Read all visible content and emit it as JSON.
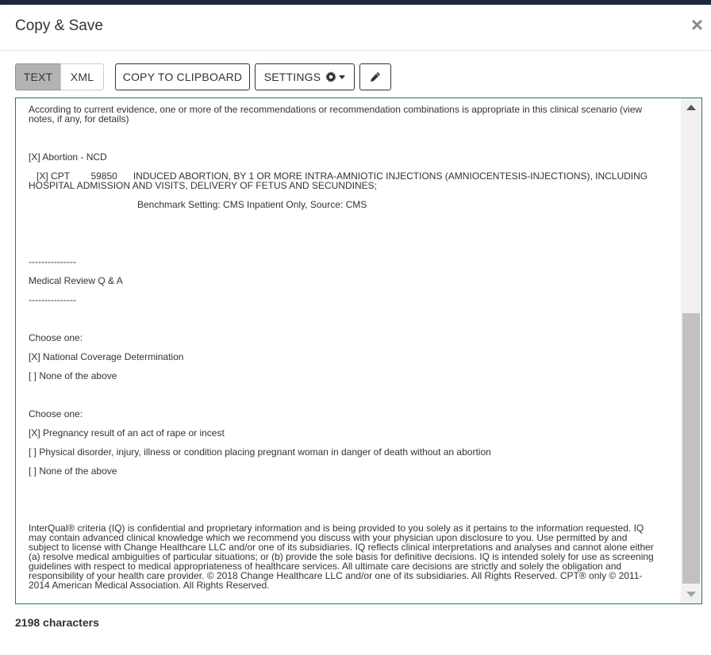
{
  "dialog": {
    "title": "Copy & Save",
    "close_label": "×"
  },
  "toolbar": {
    "text_tab": "TEXT",
    "xml_tab": "XML",
    "copy_label": "COPY TO CLIPBOARD",
    "settings_label": "SETTINGS",
    "settings_icon": "gear-icon",
    "edit_icon": "pencil-icon"
  },
  "content": {
    "lines": [
      "According to current evidence, one or more of the recommendations or recommendation combinations is appropriate in this clinical scenario (view notes, if any, for details)",
      "[X] Abortion - NCD",
      "   [X] CPT        59850      INDUCED ABORTION, BY 1 OR MORE INTRA-AMNIOTIC INJECTIONS (AMNIOCENTESIS-INJECTIONS), INCLUDING HOSPITAL ADMISSION AND VISITS, DELIVERY OF FETUS AND SECUNDINES;",
      "Benchmark Setting: CMS Inpatient Only, Source: CMS",
      "---------------",
      "Medical Review Q & A",
      "---------------",
      "Choose one:",
      "[X] National Coverage Determination",
      "[ ] None of the above",
      "Choose one:",
      "[X] Pregnancy result of an act of rape or incest",
      "[ ] Physical disorder, injury, illness or condition placing pregnant woman in danger of death without an abortion",
      "[ ] None of the above",
      "InterQual® criteria (IQ) is confidential and proprietary information and is being provided to you solely as it pertains to the information requested. IQ may contain advanced clinical knowledge which we recommend you discuss with your physician upon disclosure to you. Use permitted by and subject to license with Change Healthcare LLC and/or one of its subsidiaries. IQ reflects clinical interpretations and analyses and cannot alone either (a) resolve medical ambiguities of particular situations; or (b) provide the sole basis for definitive decisions. IQ is intended solely for use as screening guidelines with respect to medical appropriateness of healthcare services. All ultimate care decisions are strictly and solely the obligation and responsibility of your health care provider. © 2018 Change Healthcare LLC and/or one of its subsidiaries. All Rights Reserved. CPT® only © 2011-2014 American Medical Association. All Rights Reserved."
    ]
  },
  "footer": {
    "char_count": "2198 characters"
  }
}
